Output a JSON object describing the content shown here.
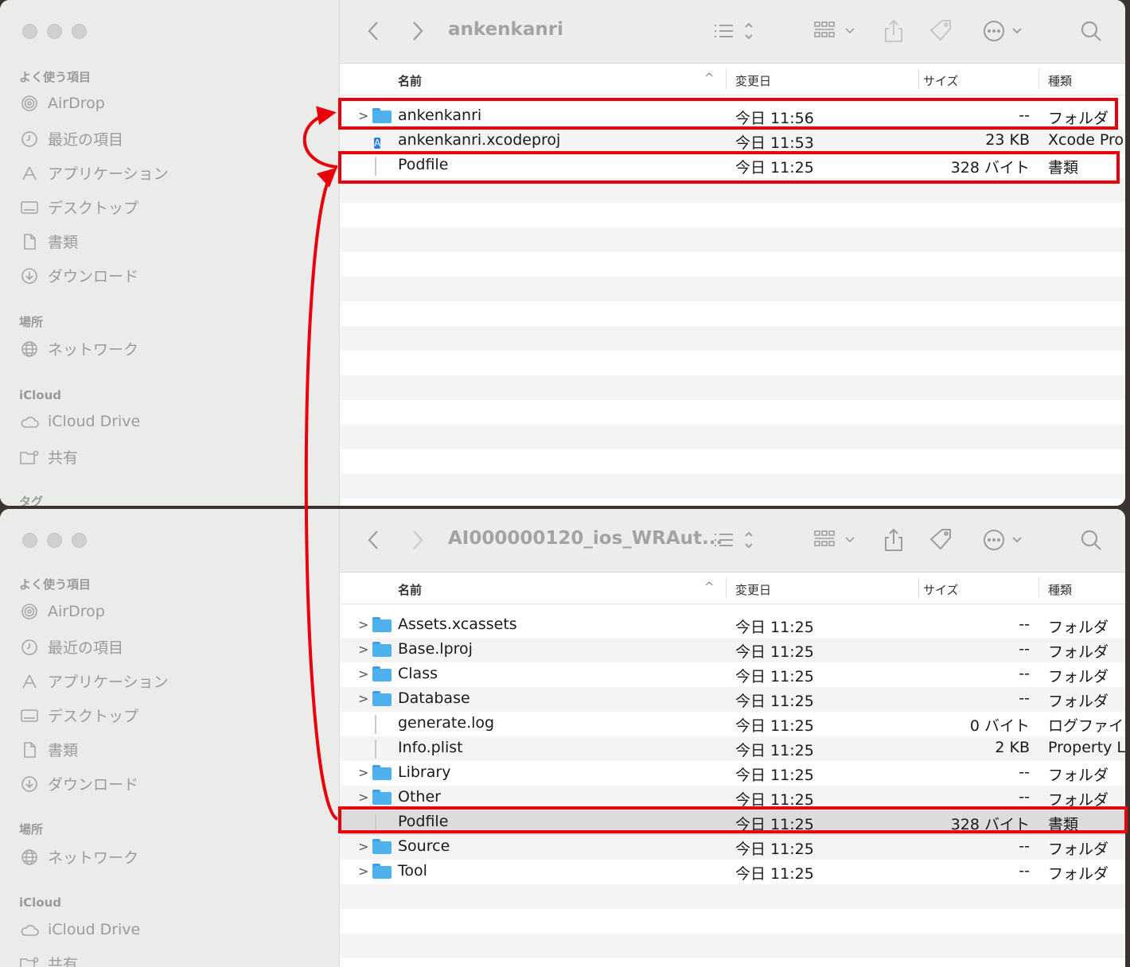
{
  "sidebar": {
    "favorites_header": "よく使う項目",
    "favorites": [
      {
        "label": "AirDrop",
        "icon": "airdrop-icon"
      },
      {
        "label": "最近の項目",
        "icon": "clock-icon"
      },
      {
        "label": "アプリケーション",
        "icon": "applications-icon"
      },
      {
        "label": "デスクトップ",
        "icon": "desktop-icon"
      },
      {
        "label": "書類",
        "icon": "document-icon"
      },
      {
        "label": "ダウンロード",
        "icon": "download-icon"
      }
    ],
    "locations_header": "場所",
    "network": "ネットワーク",
    "icloud_header": "iCloud",
    "icloud_drive": "iCloud Drive",
    "shared": "共有",
    "tags_header": "タグ"
  },
  "columns": {
    "name": "名前",
    "date": "変更日",
    "size": "サイズ",
    "kind": "種類"
  },
  "window1": {
    "title": "ankenkanri",
    "files": [
      {
        "name": "ankenkanri",
        "date": "今日 11:56",
        "size": "--",
        "kind": "フォルダ",
        "type": "folder"
      },
      {
        "name": "ankenkanri.xcodeproj",
        "date": "今日 11:53",
        "size": "23 KB",
        "kind": "Xcode Pro",
        "type": "xcode"
      },
      {
        "name": "Podfile",
        "date": "今日 11:25",
        "size": "328 バイト",
        "kind": "書類",
        "type": "doc"
      }
    ]
  },
  "window2": {
    "title": "AI000000120_ios_WRAut...",
    "files": [
      {
        "name": "Assets.xcassets",
        "date": "今日 11:25",
        "size": "--",
        "kind": "フォルダ",
        "type": "folder"
      },
      {
        "name": "Base.lproj",
        "date": "今日 11:25",
        "size": "--",
        "kind": "フォルダ",
        "type": "folder"
      },
      {
        "name": "Class",
        "date": "今日 11:25",
        "size": "--",
        "kind": "フォルダ",
        "type": "folder"
      },
      {
        "name": "Database",
        "date": "今日 11:25",
        "size": "--",
        "kind": "フォルダ",
        "type": "folder"
      },
      {
        "name": "generate.log",
        "date": "今日 11:25",
        "size": "0 バイト",
        "kind": "ログファイル",
        "type": "log"
      },
      {
        "name": "Info.plist",
        "date": "今日 11:25",
        "size": "2 KB",
        "kind": "Property L",
        "type": "plist"
      },
      {
        "name": "Library",
        "date": "今日 11:25",
        "size": "--",
        "kind": "フォルダ",
        "type": "folder"
      },
      {
        "name": "Other",
        "date": "今日 11:25",
        "size": "--",
        "kind": "フォルダ",
        "type": "folder"
      },
      {
        "name": "Podfile",
        "date": "今日 11:25",
        "size": "328 バイト",
        "kind": "書類",
        "type": "doc",
        "selected": true
      },
      {
        "name": "Source",
        "date": "今日 11:25",
        "size": "--",
        "kind": "フォルダ",
        "type": "folder"
      },
      {
        "name": "Tool",
        "date": "今日 11:25",
        "size": "--",
        "kind": "フォルダ",
        "type": "folder"
      }
    ]
  },
  "annotation_color": "#e8000b"
}
